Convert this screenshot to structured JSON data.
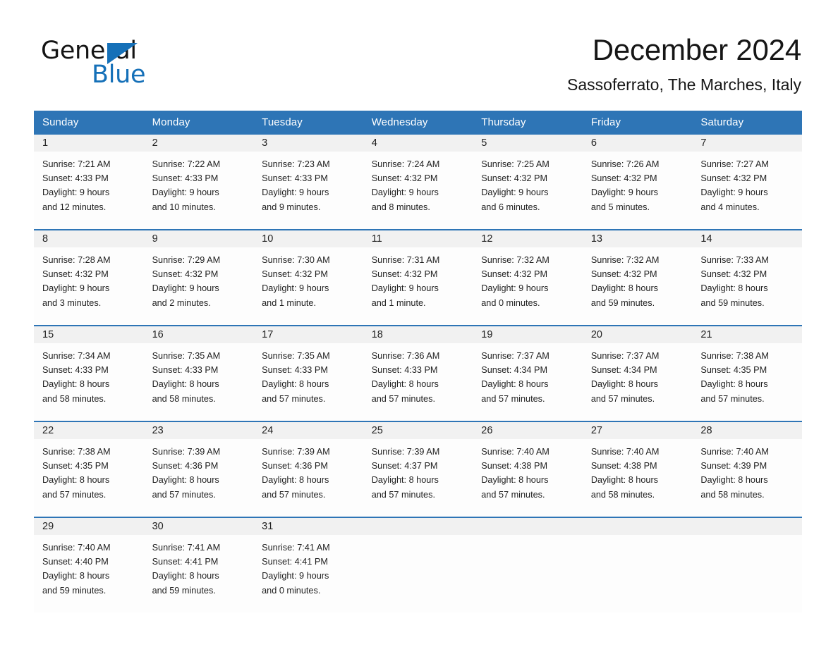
{
  "brand": {
    "name_part1": "General",
    "name_part2": "Blue",
    "accent_color": "#1570b8"
  },
  "header": {
    "month_title": "December 2024",
    "location": "Sassoferrato, The Marches, Italy"
  },
  "theme": {
    "header_blue": "#2e75b6",
    "daynum_band": "#f1f1f1",
    "text": "#1f1f1f"
  },
  "calendar": {
    "weekdays": [
      "Sunday",
      "Monday",
      "Tuesday",
      "Wednesday",
      "Thursday",
      "Friday",
      "Saturday"
    ],
    "weeks": [
      {
        "days": [
          {
            "num": "1",
            "sunrise": "Sunrise: 7:21 AM",
            "sunset": "Sunset: 4:33 PM",
            "daylight1": "Daylight: 9 hours",
            "daylight2": "and 12 minutes."
          },
          {
            "num": "2",
            "sunrise": "Sunrise: 7:22 AM",
            "sunset": "Sunset: 4:33 PM",
            "daylight1": "Daylight: 9 hours",
            "daylight2": "and 10 minutes."
          },
          {
            "num": "3",
            "sunrise": "Sunrise: 7:23 AM",
            "sunset": "Sunset: 4:33 PM",
            "daylight1": "Daylight: 9 hours",
            "daylight2": "and 9 minutes."
          },
          {
            "num": "4",
            "sunrise": "Sunrise: 7:24 AM",
            "sunset": "Sunset: 4:32 PM",
            "daylight1": "Daylight: 9 hours",
            "daylight2": "and 8 minutes."
          },
          {
            "num": "5",
            "sunrise": "Sunrise: 7:25 AM",
            "sunset": "Sunset: 4:32 PM",
            "daylight1": "Daylight: 9 hours",
            "daylight2": "and 6 minutes."
          },
          {
            "num": "6",
            "sunrise": "Sunrise: 7:26 AM",
            "sunset": "Sunset: 4:32 PM",
            "daylight1": "Daylight: 9 hours",
            "daylight2": "and 5 minutes."
          },
          {
            "num": "7",
            "sunrise": "Sunrise: 7:27 AM",
            "sunset": "Sunset: 4:32 PM",
            "daylight1": "Daylight: 9 hours",
            "daylight2": "and 4 minutes."
          }
        ]
      },
      {
        "days": [
          {
            "num": "8",
            "sunrise": "Sunrise: 7:28 AM",
            "sunset": "Sunset: 4:32 PM",
            "daylight1": "Daylight: 9 hours",
            "daylight2": "and 3 minutes."
          },
          {
            "num": "9",
            "sunrise": "Sunrise: 7:29 AM",
            "sunset": "Sunset: 4:32 PM",
            "daylight1": "Daylight: 9 hours",
            "daylight2": "and 2 minutes."
          },
          {
            "num": "10",
            "sunrise": "Sunrise: 7:30 AM",
            "sunset": "Sunset: 4:32 PM",
            "daylight1": "Daylight: 9 hours",
            "daylight2": "and 1 minute."
          },
          {
            "num": "11",
            "sunrise": "Sunrise: 7:31 AM",
            "sunset": "Sunset: 4:32 PM",
            "daylight1": "Daylight: 9 hours",
            "daylight2": "and 1 minute."
          },
          {
            "num": "12",
            "sunrise": "Sunrise: 7:32 AM",
            "sunset": "Sunset: 4:32 PM",
            "daylight1": "Daylight: 9 hours",
            "daylight2": "and 0 minutes."
          },
          {
            "num": "13",
            "sunrise": "Sunrise: 7:32 AM",
            "sunset": "Sunset: 4:32 PM",
            "daylight1": "Daylight: 8 hours",
            "daylight2": "and 59 minutes."
          },
          {
            "num": "14",
            "sunrise": "Sunrise: 7:33 AM",
            "sunset": "Sunset: 4:32 PM",
            "daylight1": "Daylight: 8 hours",
            "daylight2": "and 59 minutes."
          }
        ]
      },
      {
        "days": [
          {
            "num": "15",
            "sunrise": "Sunrise: 7:34 AM",
            "sunset": "Sunset: 4:33 PM",
            "daylight1": "Daylight: 8 hours",
            "daylight2": "and 58 minutes."
          },
          {
            "num": "16",
            "sunrise": "Sunrise: 7:35 AM",
            "sunset": "Sunset: 4:33 PM",
            "daylight1": "Daylight: 8 hours",
            "daylight2": "and 58 minutes."
          },
          {
            "num": "17",
            "sunrise": "Sunrise: 7:35 AM",
            "sunset": "Sunset: 4:33 PM",
            "daylight1": "Daylight: 8 hours",
            "daylight2": "and 57 minutes."
          },
          {
            "num": "18",
            "sunrise": "Sunrise: 7:36 AM",
            "sunset": "Sunset: 4:33 PM",
            "daylight1": "Daylight: 8 hours",
            "daylight2": "and 57 minutes."
          },
          {
            "num": "19",
            "sunrise": "Sunrise: 7:37 AM",
            "sunset": "Sunset: 4:34 PM",
            "daylight1": "Daylight: 8 hours",
            "daylight2": "and 57 minutes."
          },
          {
            "num": "20",
            "sunrise": "Sunrise: 7:37 AM",
            "sunset": "Sunset: 4:34 PM",
            "daylight1": "Daylight: 8 hours",
            "daylight2": "and 57 minutes."
          },
          {
            "num": "21",
            "sunrise": "Sunrise: 7:38 AM",
            "sunset": "Sunset: 4:35 PM",
            "daylight1": "Daylight: 8 hours",
            "daylight2": "and 57 minutes."
          }
        ]
      },
      {
        "days": [
          {
            "num": "22",
            "sunrise": "Sunrise: 7:38 AM",
            "sunset": "Sunset: 4:35 PM",
            "daylight1": "Daylight: 8 hours",
            "daylight2": "and 57 minutes."
          },
          {
            "num": "23",
            "sunrise": "Sunrise: 7:39 AM",
            "sunset": "Sunset: 4:36 PM",
            "daylight1": "Daylight: 8 hours",
            "daylight2": "and 57 minutes."
          },
          {
            "num": "24",
            "sunrise": "Sunrise: 7:39 AM",
            "sunset": "Sunset: 4:36 PM",
            "daylight1": "Daylight: 8 hours",
            "daylight2": "and 57 minutes."
          },
          {
            "num": "25",
            "sunrise": "Sunrise: 7:39 AM",
            "sunset": "Sunset: 4:37 PM",
            "daylight1": "Daylight: 8 hours",
            "daylight2": "and 57 minutes."
          },
          {
            "num": "26",
            "sunrise": "Sunrise: 7:40 AM",
            "sunset": "Sunset: 4:38 PM",
            "daylight1": "Daylight: 8 hours",
            "daylight2": "and 57 minutes."
          },
          {
            "num": "27",
            "sunrise": "Sunrise: 7:40 AM",
            "sunset": "Sunset: 4:38 PM",
            "daylight1": "Daylight: 8 hours",
            "daylight2": "and 58 minutes."
          },
          {
            "num": "28",
            "sunrise": "Sunrise: 7:40 AM",
            "sunset": "Sunset: 4:39 PM",
            "daylight1": "Daylight: 8 hours",
            "daylight2": "and 58 minutes."
          }
        ]
      },
      {
        "days": [
          {
            "num": "29",
            "sunrise": "Sunrise: 7:40 AM",
            "sunset": "Sunset: 4:40 PM",
            "daylight1": "Daylight: 8 hours",
            "daylight2": "and 59 minutes."
          },
          {
            "num": "30",
            "sunrise": "Sunrise: 7:41 AM",
            "sunset": "Sunset: 4:41 PM",
            "daylight1": "Daylight: 8 hours",
            "daylight2": "and 59 minutes."
          },
          {
            "num": "31",
            "sunrise": "Sunrise: 7:41 AM",
            "sunset": "Sunset: 4:41 PM",
            "daylight1": "Daylight: 9 hours",
            "daylight2": "and 0 minutes."
          },
          {
            "num": "",
            "sunrise": "",
            "sunset": "",
            "daylight1": "",
            "daylight2": ""
          },
          {
            "num": "",
            "sunrise": "",
            "sunset": "",
            "daylight1": "",
            "daylight2": ""
          },
          {
            "num": "",
            "sunrise": "",
            "sunset": "",
            "daylight1": "",
            "daylight2": ""
          },
          {
            "num": "",
            "sunrise": "",
            "sunset": "",
            "daylight1": "",
            "daylight2": ""
          }
        ]
      }
    ]
  }
}
